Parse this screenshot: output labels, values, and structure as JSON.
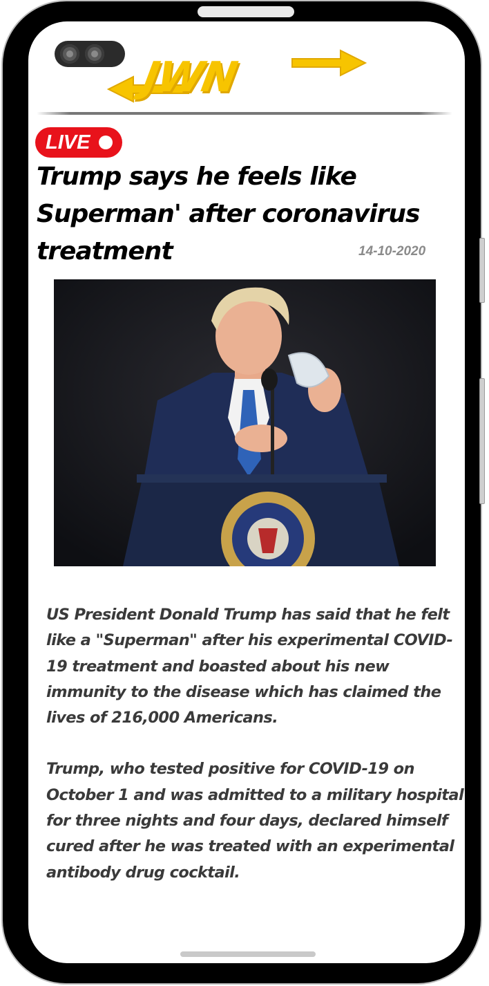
{
  "app": {
    "logo_text": "JWN"
  },
  "live_badge": {
    "label": "LIVE"
  },
  "article": {
    "headline": "Trump says he feels like Superman' after coronavirus treatment",
    "date": "14-10-2020",
    "paragraphs": [
      "US President Donald Trump has said that he felt like a \"Superman\" after his experimental COVID-19 treatment and boasted about his new immunity to the disease which has claimed the lives of 216,000 Americans.",
      "Trump, who tested positive for COVID-19 on October 1 and was admitted to a military hospital for three nights and four days, declared himself cured after he was treated with an experimental antibody drug cocktail."
    ]
  },
  "colors": {
    "live_red": "#e8121b",
    "logo_yellow": "#f7c400",
    "date_gray": "#8a8a8a",
    "body_text": "#3a3a3a"
  }
}
